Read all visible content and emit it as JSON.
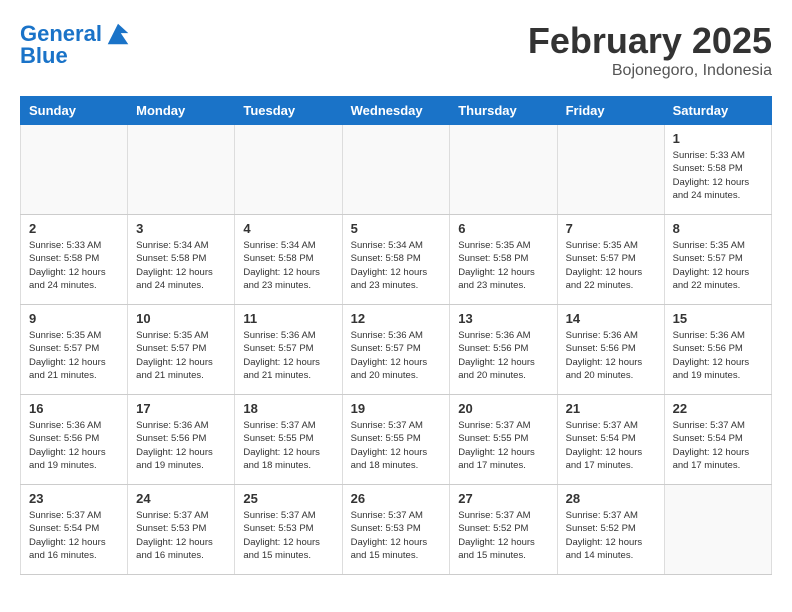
{
  "header": {
    "logo_line1": "General",
    "logo_line2": "Blue",
    "month": "February 2025",
    "location": "Bojonegoro, Indonesia"
  },
  "days_of_week": [
    "Sunday",
    "Monday",
    "Tuesday",
    "Wednesday",
    "Thursday",
    "Friday",
    "Saturday"
  ],
  "weeks": [
    [
      {
        "day": "",
        "info": ""
      },
      {
        "day": "",
        "info": ""
      },
      {
        "day": "",
        "info": ""
      },
      {
        "day": "",
        "info": ""
      },
      {
        "day": "",
        "info": ""
      },
      {
        "day": "",
        "info": ""
      },
      {
        "day": "1",
        "info": "Sunrise: 5:33 AM\nSunset: 5:58 PM\nDaylight: 12 hours\nand 24 minutes."
      }
    ],
    [
      {
        "day": "2",
        "info": "Sunrise: 5:33 AM\nSunset: 5:58 PM\nDaylight: 12 hours\nand 24 minutes."
      },
      {
        "day": "3",
        "info": "Sunrise: 5:34 AM\nSunset: 5:58 PM\nDaylight: 12 hours\nand 24 minutes."
      },
      {
        "day": "4",
        "info": "Sunrise: 5:34 AM\nSunset: 5:58 PM\nDaylight: 12 hours\nand 23 minutes."
      },
      {
        "day": "5",
        "info": "Sunrise: 5:34 AM\nSunset: 5:58 PM\nDaylight: 12 hours\nand 23 minutes."
      },
      {
        "day": "6",
        "info": "Sunrise: 5:35 AM\nSunset: 5:58 PM\nDaylight: 12 hours\nand 23 minutes."
      },
      {
        "day": "7",
        "info": "Sunrise: 5:35 AM\nSunset: 5:57 PM\nDaylight: 12 hours\nand 22 minutes."
      },
      {
        "day": "8",
        "info": "Sunrise: 5:35 AM\nSunset: 5:57 PM\nDaylight: 12 hours\nand 22 minutes."
      }
    ],
    [
      {
        "day": "9",
        "info": "Sunrise: 5:35 AM\nSunset: 5:57 PM\nDaylight: 12 hours\nand 21 minutes."
      },
      {
        "day": "10",
        "info": "Sunrise: 5:35 AM\nSunset: 5:57 PM\nDaylight: 12 hours\nand 21 minutes."
      },
      {
        "day": "11",
        "info": "Sunrise: 5:36 AM\nSunset: 5:57 PM\nDaylight: 12 hours\nand 21 minutes."
      },
      {
        "day": "12",
        "info": "Sunrise: 5:36 AM\nSunset: 5:57 PM\nDaylight: 12 hours\nand 20 minutes."
      },
      {
        "day": "13",
        "info": "Sunrise: 5:36 AM\nSunset: 5:56 PM\nDaylight: 12 hours\nand 20 minutes."
      },
      {
        "day": "14",
        "info": "Sunrise: 5:36 AM\nSunset: 5:56 PM\nDaylight: 12 hours\nand 20 minutes."
      },
      {
        "day": "15",
        "info": "Sunrise: 5:36 AM\nSunset: 5:56 PM\nDaylight: 12 hours\nand 19 minutes."
      }
    ],
    [
      {
        "day": "16",
        "info": "Sunrise: 5:36 AM\nSunset: 5:56 PM\nDaylight: 12 hours\nand 19 minutes."
      },
      {
        "day": "17",
        "info": "Sunrise: 5:36 AM\nSunset: 5:56 PM\nDaylight: 12 hours\nand 19 minutes."
      },
      {
        "day": "18",
        "info": "Sunrise: 5:37 AM\nSunset: 5:55 PM\nDaylight: 12 hours\nand 18 minutes."
      },
      {
        "day": "19",
        "info": "Sunrise: 5:37 AM\nSunset: 5:55 PM\nDaylight: 12 hours\nand 18 minutes."
      },
      {
        "day": "20",
        "info": "Sunrise: 5:37 AM\nSunset: 5:55 PM\nDaylight: 12 hours\nand 17 minutes."
      },
      {
        "day": "21",
        "info": "Sunrise: 5:37 AM\nSunset: 5:54 PM\nDaylight: 12 hours\nand 17 minutes."
      },
      {
        "day": "22",
        "info": "Sunrise: 5:37 AM\nSunset: 5:54 PM\nDaylight: 12 hours\nand 17 minutes."
      }
    ],
    [
      {
        "day": "23",
        "info": "Sunrise: 5:37 AM\nSunset: 5:54 PM\nDaylight: 12 hours\nand 16 minutes."
      },
      {
        "day": "24",
        "info": "Sunrise: 5:37 AM\nSunset: 5:53 PM\nDaylight: 12 hours\nand 16 minutes."
      },
      {
        "day": "25",
        "info": "Sunrise: 5:37 AM\nSunset: 5:53 PM\nDaylight: 12 hours\nand 15 minutes."
      },
      {
        "day": "26",
        "info": "Sunrise: 5:37 AM\nSunset: 5:53 PM\nDaylight: 12 hours\nand 15 minutes."
      },
      {
        "day": "27",
        "info": "Sunrise: 5:37 AM\nSunset: 5:52 PM\nDaylight: 12 hours\nand 15 minutes."
      },
      {
        "day": "28",
        "info": "Sunrise: 5:37 AM\nSunset: 5:52 PM\nDaylight: 12 hours\nand 14 minutes."
      },
      {
        "day": "",
        "info": ""
      }
    ]
  ]
}
